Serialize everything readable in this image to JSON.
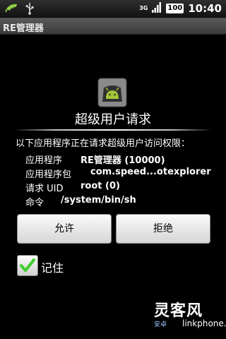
{
  "status_bar": {
    "network_label": "3G",
    "battery_level": "100",
    "time": "10:40"
  },
  "title_bar": {
    "title": "RE管理器"
  },
  "dialog": {
    "title": "超级用户请求",
    "prompt": "以下应用程序正在请求超级用户访问权限：",
    "info_rows": [
      {
        "label": "应用程序",
        "value": "RE管理器 (10000)"
      },
      {
        "label": "应用程序包",
        "value": "com.speed...otexplorer"
      },
      {
        "label": "请求 UID",
        "value": "root (0)"
      },
      {
        "label": "命令",
        "value": "/system/bin/sh"
      }
    ],
    "allow_label": "允许",
    "deny_label": "拒绝",
    "remember_label": "记住",
    "remember_checked": true
  },
  "watermark": {
    "brand": "灵客风",
    "domain": "linkphone.cn",
    "sub": "安卓"
  }
}
